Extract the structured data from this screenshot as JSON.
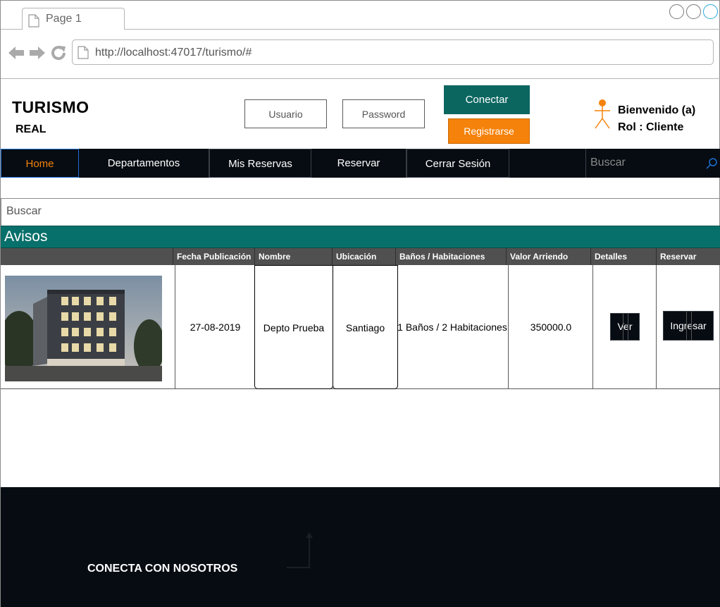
{
  "browser": {
    "tab_title": "Page 1",
    "url": "http://localhost:47017/turismo/#"
  },
  "header": {
    "brand_title": "TURISMO",
    "brand_subtitle": "REAL",
    "username_placeholder": "Usuario",
    "password_placeholder": "Password",
    "connect_label": "Conectar",
    "register_label": "Registrarse",
    "welcome_line1": "Bienvenido (a)",
    "welcome_line2": "Rol : Cliente"
  },
  "nav": {
    "items": [
      {
        "label": "Home",
        "active": true
      },
      {
        "label": "Departamentos"
      },
      {
        "label": "Mis Reservas"
      },
      {
        "label": "Reservar"
      },
      {
        "label": "Cerrar Sesión"
      }
    ],
    "search_placeholder": "Buscar"
  },
  "content": {
    "search_placeholder": "Buscar",
    "section_title": "Avisos",
    "table": {
      "headers": [
        "",
        "Fecha Publicación",
        "Nombre",
        "Ubicación",
        "Baños / Habitaciones",
        "Valor Arriendo",
        "Detalles",
        "Reservar"
      ],
      "rows": [
        {
          "fecha": "27-08-2019",
          "nombre": "Depto Prueba",
          "ubicacion": "Santiago",
          "banos_habitaciones": "1 Baños / 2 Habitaciones",
          "valor": "350000.0",
          "detalles_label": "Ver",
          "reservar_label": "Ingresar"
        }
      ]
    }
  },
  "footer": {
    "label": "CONECTA CON NOSOTROS"
  },
  "colors": {
    "accent_teal": "#0b6660",
    "accent_orange": "#f5820a",
    "nav_dark": "#060c12"
  }
}
